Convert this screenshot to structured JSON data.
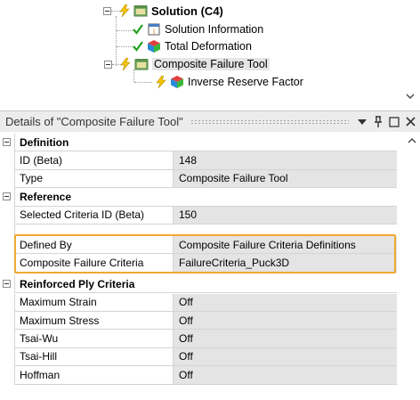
{
  "tree": {
    "items": [
      {
        "label": "Solution (C4)",
        "bold": true
      },
      {
        "label": "Solution Information"
      },
      {
        "label": "Total Deformation"
      },
      {
        "label": "Composite Failure Tool",
        "selected": true
      },
      {
        "label": "Inverse Reserve Factor"
      }
    ]
  },
  "details": {
    "title": "Details of \"Composite Failure Tool\"",
    "buttons": {
      "dropdown": "▼",
      "pin": "ᛘ",
      "maximize": "☐",
      "close": "✕"
    }
  },
  "grid": {
    "definition": {
      "label": "Definition",
      "rows": [
        {
          "name": "ID (Beta)",
          "value": "148"
        },
        {
          "name": "Type",
          "value": "Composite Failure Tool"
        }
      ]
    },
    "reference": {
      "label": "Reference",
      "rows": [
        {
          "name": "Selected Criteria ID (Beta)",
          "value": "150"
        },
        {
          "name": "Defined By",
          "value": "Composite Failure Criteria Definitions"
        },
        {
          "name": "Composite Failure Criteria",
          "value": "FailureCriteria_Puck3D"
        }
      ]
    },
    "ply": {
      "label": "Reinforced Ply Criteria",
      "rows": [
        {
          "name": "Maximum Strain",
          "value": "Off"
        },
        {
          "name": "Maximum Stress",
          "value": "Off"
        },
        {
          "name": "Tsai-Wu",
          "value": "Off"
        },
        {
          "name": "Tsai-Hill",
          "value": "Off"
        },
        {
          "name": "Hoffman",
          "value": "Off"
        }
      ]
    }
  },
  "colors": {
    "highlight": "#f0a830",
    "check": "#22a022",
    "lightning": "#f5c400",
    "value_bg": "#e4e4e4"
  }
}
